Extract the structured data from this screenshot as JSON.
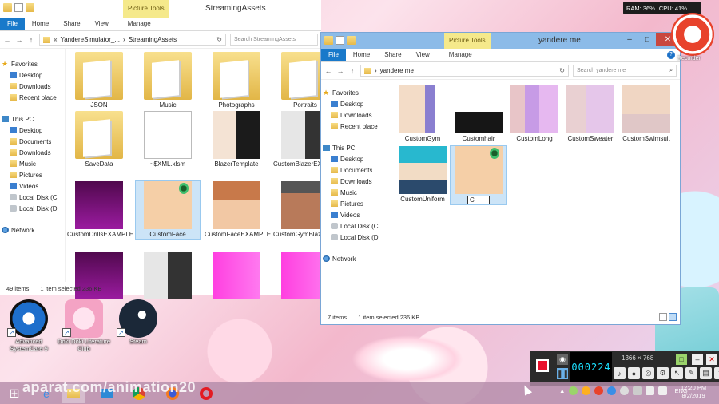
{
  "overlay": {
    "ram": "RAM: 36%",
    "cpu": "CPU: 41%",
    "recorder_label": "Recorder",
    "rec_time": "000224",
    "rec_resolution": "1366 × 768",
    "watermark": "aparat.com/animation20"
  },
  "win_left": {
    "context_tab": "Picture Tools",
    "title": "StreamingAssets",
    "ribbon": [
      "File",
      "Home",
      "Share",
      "View",
      "Manage"
    ],
    "path": [
      "« ",
      "YandereSimulator_...",
      "›",
      "StreamingAssets"
    ],
    "search_placeholder": "Search StreamingAssets",
    "nav": [
      {
        "label": "Favorites",
        "icon": "star-icon"
      },
      {
        "label": "Desktop",
        "icon": "desktop-icon"
      },
      {
        "label": "Downloads",
        "icon": "downloads-icon"
      },
      {
        "label": "Recent place",
        "icon": "recent-icon"
      },
      {
        "label": "This PC",
        "icon": "computer-icon"
      },
      {
        "label": "Desktop",
        "icon": "desktop-icon"
      },
      {
        "label": "Documents",
        "icon": "folder-icon"
      },
      {
        "label": "Downloads",
        "icon": "downloads-icon"
      },
      {
        "label": "Music",
        "icon": "music-icon"
      },
      {
        "label": "Pictures",
        "icon": "pictures-icon"
      },
      {
        "label": "Videos",
        "icon": "videos-icon"
      },
      {
        "label": "Local Disk (C",
        "icon": "disk-icon"
      },
      {
        "label": "Local Disk (D",
        "icon": "disk-icon"
      },
      {
        "label": "Network",
        "icon": "network-icon"
      }
    ],
    "items": [
      {
        "label": "JSON",
        "tex": "f-big"
      },
      {
        "label": "Music",
        "tex": "f-big"
      },
      {
        "label": "Photographs",
        "tex": "f-big"
      },
      {
        "label": "Portraits",
        "tex": "f-big"
      },
      {
        "label": "SaveData",
        "tex": "f-big"
      },
      {
        "label": "~$XML.xlsm",
        "tex": "tex-xml"
      },
      {
        "label": "BlazerTemplate",
        "tex": "tex-blazer"
      },
      {
        "label": "CustomBlazerEXAMPLE",
        "tex": "tex-grey"
      },
      {
        "label": "CustomDrillsEXAMPLE",
        "tex": "tex-purple"
      },
      {
        "label": "CustomFace",
        "tex": "tex-face"
      },
      {
        "label": "CustomFaceEXAMPLE",
        "tex": "tex-faceexa"
      },
      {
        "label": "CustomGymBlazerEXAMPLE",
        "tex": "tex-gymblz"
      },
      {
        "label": "",
        "tex": "tex-purple"
      },
      {
        "label": "",
        "tex": "tex-grey"
      },
      {
        "label": "",
        "tex": "tex-pink"
      },
      {
        "label": "",
        "tex": "tex-pink"
      }
    ],
    "status_count": "49 items",
    "status_selected": "1 item selected  236 KB"
  },
  "win_right": {
    "context_tab": "Picture Tools",
    "title": "yandere me",
    "ribbon": [
      "File",
      "Home",
      "Share",
      "View",
      "Manage"
    ],
    "path": [
      "yandere me"
    ],
    "search_placeholder": "Search yandere me",
    "nav": [
      {
        "label": "Favorites",
        "icon": "star-icon"
      },
      {
        "label": "Desktop",
        "icon": "desktop-icon"
      },
      {
        "label": "Downloads",
        "icon": "downloads-icon"
      },
      {
        "label": "Recent place",
        "icon": "recent-icon"
      },
      {
        "label": "This PC",
        "icon": "computer-icon"
      },
      {
        "label": "Desktop",
        "icon": "desktop-icon"
      },
      {
        "label": "Documents",
        "icon": "folder-icon"
      },
      {
        "label": "Downloads",
        "icon": "downloads-icon"
      },
      {
        "label": "Music",
        "icon": "music-icon"
      },
      {
        "label": "Pictures",
        "icon": "pictures-icon"
      },
      {
        "label": "Videos",
        "icon": "videos-icon"
      },
      {
        "label": "Local Disk (C",
        "icon": "disk-icon"
      },
      {
        "label": "Local Disk (D",
        "icon": "disk-icon"
      },
      {
        "label": "Network",
        "icon": "network-icon"
      }
    ],
    "items": [
      {
        "label": "CustomGym",
        "tex": "tex-gym"
      },
      {
        "label": "Customhair",
        "tex": "tex-hair"
      },
      {
        "label": "CustomLong",
        "tex": "tex-long"
      },
      {
        "label": "CustomSweater",
        "tex": "tex-sweat"
      },
      {
        "label": "CustomSwimsuit",
        "tex": "tex-swim"
      },
      {
        "label": "CustomUniform",
        "tex": "tex-uni"
      },
      {
        "label": "C",
        "tex": "tex-face"
      }
    ],
    "status_count": "7 items",
    "status_selected": "1 item selected  236 KB"
  },
  "desktop": [
    {
      "label": "Advanced SystemCare 9",
      "color": "#1e6fcc"
    },
    {
      "label": "Doki Doki Literature Club",
      "color": "#f4a3c4"
    },
    {
      "label": "Steam",
      "color": "#1b2838"
    }
  ],
  "clock": {
    "time": "12:20 PM",
    "date": "8/2/2019"
  },
  "tray_lang": "ENG"
}
